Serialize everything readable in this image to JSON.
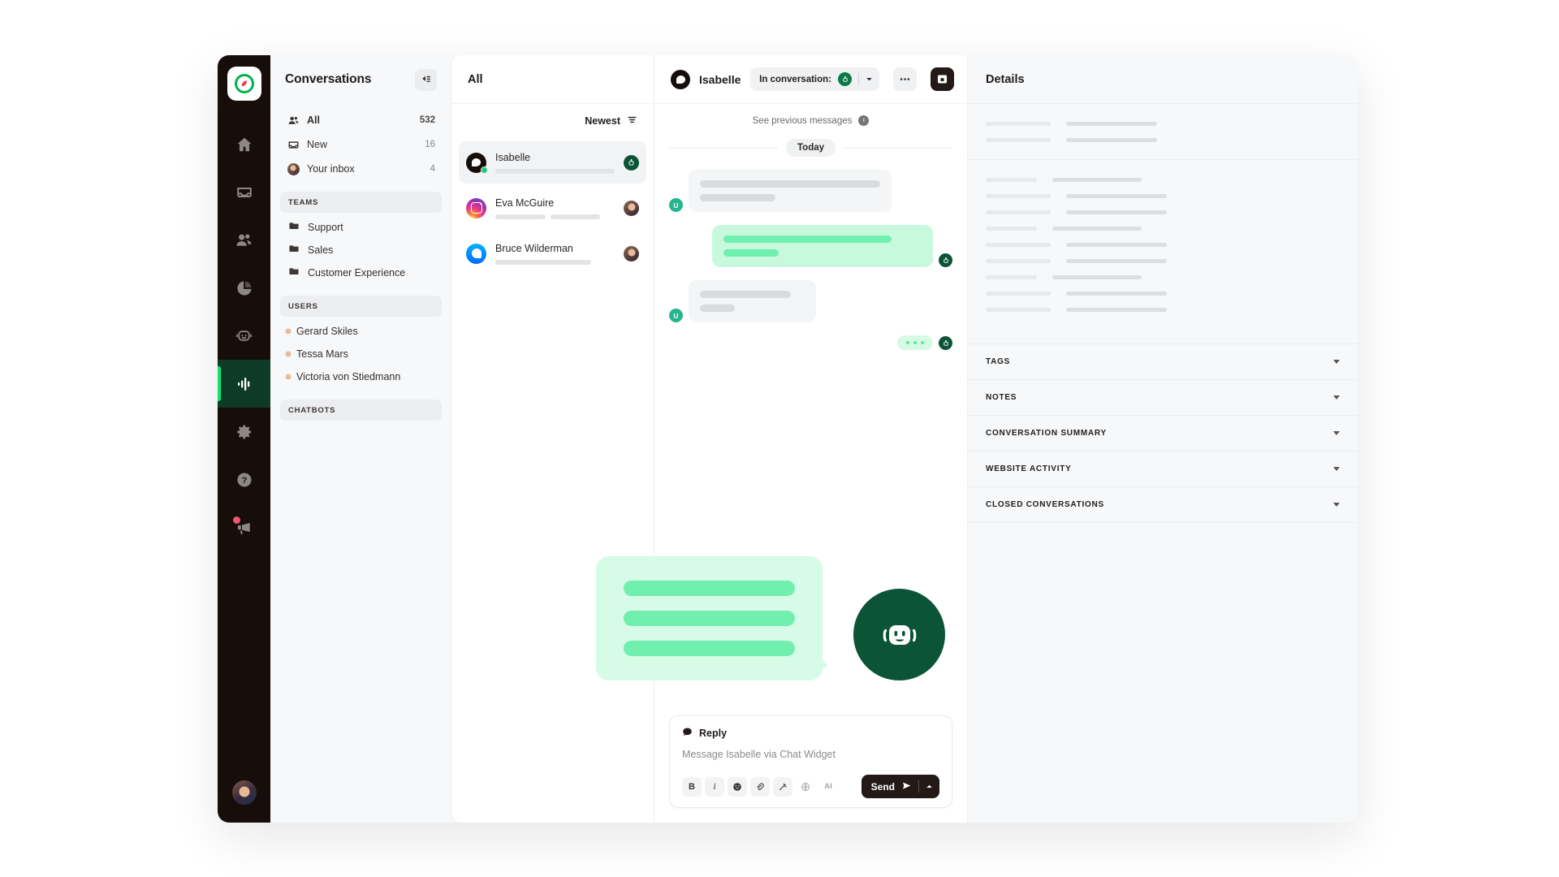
{
  "rail": {
    "logo_icon": "tidio-logo-icon",
    "items": [
      {
        "icon": "home-icon",
        "name": "rail-item-home"
      },
      {
        "icon": "inbox-icon",
        "name": "rail-item-inbox"
      },
      {
        "icon": "contacts-icon",
        "name": "rail-item-contacts"
      },
      {
        "icon": "pie-chart-icon",
        "name": "rail-item-analytics"
      },
      {
        "icon": "bot-icon",
        "name": "rail-item-chatbots"
      },
      {
        "icon": "waveform-icon",
        "name": "rail-item-insights",
        "active": true
      },
      {
        "icon": "gear-icon",
        "name": "rail-item-settings"
      },
      {
        "icon": "help-icon",
        "name": "rail-item-help"
      },
      {
        "icon": "megaphone-icon",
        "name": "rail-item-announcements",
        "badge": true
      }
    ],
    "account_avatar": "user-avatar"
  },
  "sidebar": {
    "title": "Conversations",
    "collapse_icon": "collapse-panel-icon",
    "nav": [
      {
        "label": "All",
        "count": "532",
        "icon": "people-icon",
        "bold": true
      },
      {
        "label": "New",
        "count": "16",
        "icon": "inbox-icon"
      },
      {
        "label": "Your inbox",
        "count": "4",
        "icon": "avatar-icon"
      }
    ],
    "teams_header": "TEAMS",
    "teams": [
      {
        "label": "Support",
        "icon": "folder-icon"
      },
      {
        "label": "Sales",
        "icon": "folder-icon"
      },
      {
        "label": "Customer Experience",
        "icon": "folder-icon"
      }
    ],
    "users_header": "USERS",
    "users": [
      {
        "label": "Gerard Skiles",
        "icon": "avatar-icon"
      },
      {
        "label": "Tessa Mars",
        "icon": "avatar-icon"
      },
      {
        "label": "Victoria von Stiedmann",
        "icon": "avatar-icon"
      }
    ],
    "chatbots_header": "CHATBOTS"
  },
  "list": {
    "title": "All",
    "sort_label": "Newest",
    "sort_icon": "filter-icon",
    "items": [
      {
        "name": "Isabelle",
        "channel": "chat-widget",
        "selected": true,
        "end_icon": "bot-badge-icon",
        "online": true
      },
      {
        "name": "Eva McGuire",
        "channel": "instagram",
        "selected": false,
        "end_icon": "agent-avatar-icon",
        "online": false
      },
      {
        "name": "Bruce Wilderman",
        "channel": "messenger",
        "selected": false,
        "end_icon": "agent-avatar-icon",
        "online": false
      }
    ]
  },
  "chat": {
    "contact_name": "Isabelle",
    "contact_icon": "chat-widget-icon",
    "assignment_label": "In conversation:",
    "assignment_bot_icon": "bot-icon",
    "assignment_caret_icon": "chevron-down-icon",
    "more_icon": "more-horizontal-icon",
    "archive_icon": "archive-icon",
    "see_previous": "See previous messages",
    "see_previous_icon": "clock-icon",
    "day_separator": "Today",
    "messages": [
      {
        "side": "in",
        "avatar": "U",
        "lines": [
          100,
          42
        ]
      },
      {
        "side": "out",
        "avatar": "bot",
        "lines": [
          100,
          31
        ]
      },
      {
        "side": "in",
        "avatar": "U",
        "lines": [
          100,
          36
        ]
      },
      {
        "side": "typing",
        "avatar": "bot"
      }
    ]
  },
  "overlay": {
    "bubble_lines": 3,
    "bot_icon": "chatbot-face-icon"
  },
  "reply": {
    "tab_label": "Reply",
    "tab_icon": "speech-bubble-icon",
    "placeholder": "Message Isabelle via Chat Widget",
    "tools": [
      {
        "label": "B",
        "name": "bold-icon"
      },
      {
        "label": "i",
        "name": "italic-icon"
      },
      {
        "label": "☺",
        "name": "emoji-icon"
      },
      {
        "label": "🔗",
        "name": "attachment-icon"
      },
      {
        "label": "✨",
        "name": "magic-wand-icon"
      },
      {
        "label": "🌐",
        "name": "translate-icon"
      },
      {
        "label": "AI",
        "name": "ai-icon"
      }
    ],
    "send_label": "Send",
    "send_icon": "send-arrow-icon",
    "send_more_icon": "chevron-up-icon"
  },
  "details": {
    "title": "Details",
    "sections": [
      {
        "label": "TAGS",
        "caret": "chevron-down-icon"
      },
      {
        "label": "NOTES",
        "caret": "chevron-down-icon"
      },
      {
        "label": "CONVERSATION SUMMARY",
        "caret": "chevron-down-icon"
      },
      {
        "label": "WEBSITE ACTIVITY",
        "caret": "chevron-down-icon"
      },
      {
        "label": "CLOSED CONVERSATIONS",
        "caret": "chevron-down-icon"
      }
    ],
    "top_rows": [
      [
        74,
        112
      ],
      [
        74,
        112
      ]
    ],
    "main_rows": [
      [
        63,
        110
      ],
      [
        74,
        124
      ],
      [
        74,
        124
      ],
      [
        63,
        110
      ],
      [
        74,
        124
      ],
      [
        74,
        124
      ],
      [
        63,
        110
      ],
      [
        74,
        124
      ],
      [
        74,
        124
      ]
    ]
  },
  "colors": {
    "rail_bg": "#170d0a",
    "accent_green": "#0ee678",
    "bot_dark_green": "#0b5437",
    "bubble_out": "#c9f9dd",
    "bubble_out_line": "#6ff0ae",
    "user_avatar": "#27b58f"
  }
}
